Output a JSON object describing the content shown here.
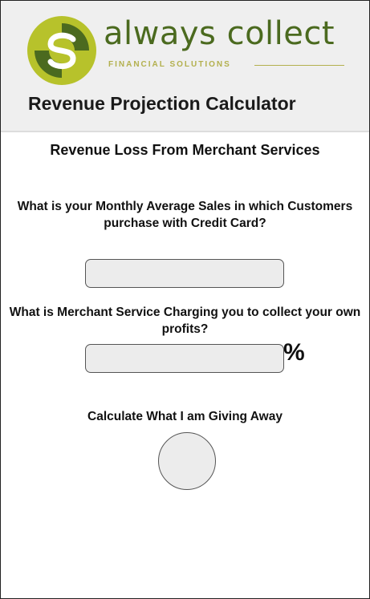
{
  "brand": {
    "name": "always collect",
    "tagline": "FINANCIAL SOLUTIONS",
    "colors": {
      "primary": "#4b6a1f",
      "accent": "#b3b04e"
    }
  },
  "header": {
    "title": "Revenue Projection Calculator"
  },
  "calculator": {
    "section_title": "Revenue Loss From Merchant Services",
    "question_sales": "What is your Monthly Average Sales in which Customers purchase with Credit Card?",
    "sales_value": "",
    "question_rate": "What is Merchant Service Charging you to collect your own profits?",
    "rate_value": "",
    "percent_symbol": "%",
    "calculate_label": "Calculate What I am Giving Away"
  }
}
